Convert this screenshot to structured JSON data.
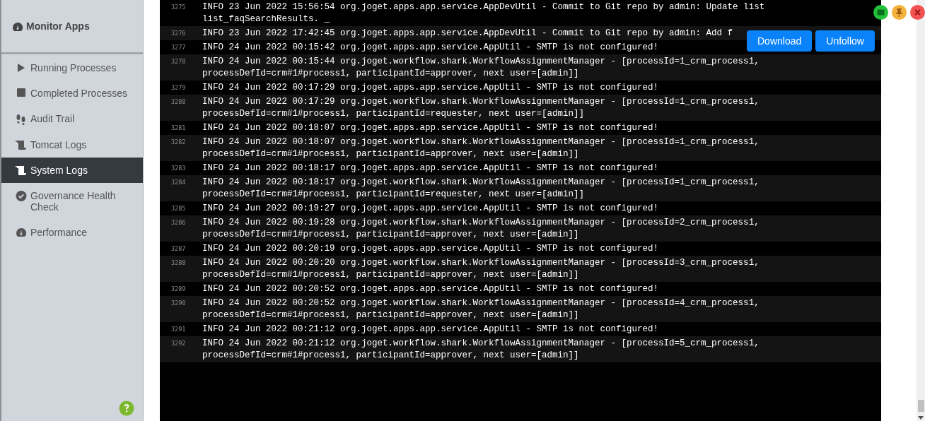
{
  "sidebar": {
    "title": "Monitor Apps",
    "items": [
      {
        "label": "Running Processes",
        "selected": false
      },
      {
        "label": "Completed Processes",
        "selected": false
      },
      {
        "label": "Audit Trail",
        "selected": false
      },
      {
        "label": "Tomcat Logs",
        "selected": false
      },
      {
        "label": "System Logs",
        "selected": true
      },
      {
        "label": "Governance Health Check",
        "selected": false
      },
      {
        "label": "Performance",
        "selected": false
      }
    ]
  },
  "log": {
    "lines": [
      {
        "number": "3275",
        "text": "INFO 23 Jun 2022 15:56:54 org.joget.apps.app.service.AppDevUtil - Commit to Git repo by admin: Update list list_faqSearchResults. _"
      },
      {
        "number": "3276",
        "text": "INFO 23 Jun 2022 17:42:45 org.joget.apps.app.service.AppDevUtil - Commit to Git repo by admin: Add f"
      },
      {
        "number": "3277",
        "text": "INFO 24 Jun 2022 00:15:42 org.joget.apps.app.service.AppUtil - SMTP is not configured!"
      },
      {
        "number": "3278",
        "text": "INFO 24 Jun 2022 00:15:44 org.joget.workflow.shark.WorkflowAssignmentManager - [processId=1_crm_process1, processDefId=crm#1#process1, participantId=approver, next user=[admin]]"
      },
      {
        "number": "3279",
        "text": "INFO 24 Jun 2022 00:17:29 org.joget.apps.app.service.AppUtil - SMTP is not configured!"
      },
      {
        "number": "3280",
        "text": "INFO 24 Jun 2022 00:17:29 org.joget.workflow.shark.WorkflowAssignmentManager - [processId=1_crm_process1, processDefId=crm#1#process1, participantId=requester, next user=[admin]]"
      },
      {
        "number": "3281",
        "text": "INFO 24 Jun 2022 00:18:07 org.joget.apps.app.service.AppUtil - SMTP is not configured!"
      },
      {
        "number": "3282",
        "text": "INFO 24 Jun 2022 00:18:07 org.joget.workflow.shark.WorkflowAssignmentManager - [processId=1_crm_process1, processDefId=crm#1#process1, participantId=approver, next user=[admin]]"
      },
      {
        "number": "3283",
        "text": "INFO 24 Jun 2022 00:18:17 org.joget.apps.app.service.AppUtil - SMTP is not configured!"
      },
      {
        "number": "3284",
        "text": "INFO 24 Jun 2022 00:18:17 org.joget.workflow.shark.WorkflowAssignmentManager - [processId=1_crm_process1, processDefId=crm#1#process1, participantId=requester, next user=[admin]]"
      },
      {
        "number": "3285",
        "text": "INFO 24 Jun 2022 00:19:27 org.joget.apps.app.service.AppUtil - SMTP is not configured!"
      },
      {
        "number": "3286",
        "text": "INFO 24 Jun 2022 00:19:28 org.joget.workflow.shark.WorkflowAssignmentManager - [processId=2_crm_process1, processDefId=crm#1#process1, participantId=approver, next user=[admin]]"
      },
      {
        "number": "3287",
        "text": "INFO 24 Jun 2022 00:20:19 org.joget.apps.app.service.AppUtil - SMTP is not configured!"
      },
      {
        "number": "3288",
        "text": "INFO 24 Jun 2022 00:20:20 org.joget.workflow.shark.WorkflowAssignmentManager - [processId=3_crm_process1, processDefId=crm#1#process1, participantId=approver, next user=[admin]]"
      },
      {
        "number": "3289",
        "text": "INFO 24 Jun 2022 00:20:52 org.joget.apps.app.service.AppUtil - SMTP is not configured!"
      },
      {
        "number": "3290",
        "text": "INFO 24 Jun 2022 00:20:52 org.joget.workflow.shark.WorkflowAssignmentManager - [processId=4_crm_process1, processDefId=crm#1#process1, participantId=approver, next user=[admin]]"
      },
      {
        "number": "3291",
        "text": "INFO 24 Jun 2022 00:21:12 org.joget.apps.app.service.AppUtil - SMTP is not configured!"
      },
      {
        "number": "3292",
        "text": "INFO 24 Jun 2022 00:21:12 org.joget.workflow.shark.WorkflowAssignmentManager - [processId=5_crm_process1, processDefId=crm#1#process1, participantId=approver, next user=[admin]]"
      }
    ]
  },
  "buttons": [
    {
      "label": "Download"
    },
    {
      "label": "Unfollow"
    }
  ]
}
